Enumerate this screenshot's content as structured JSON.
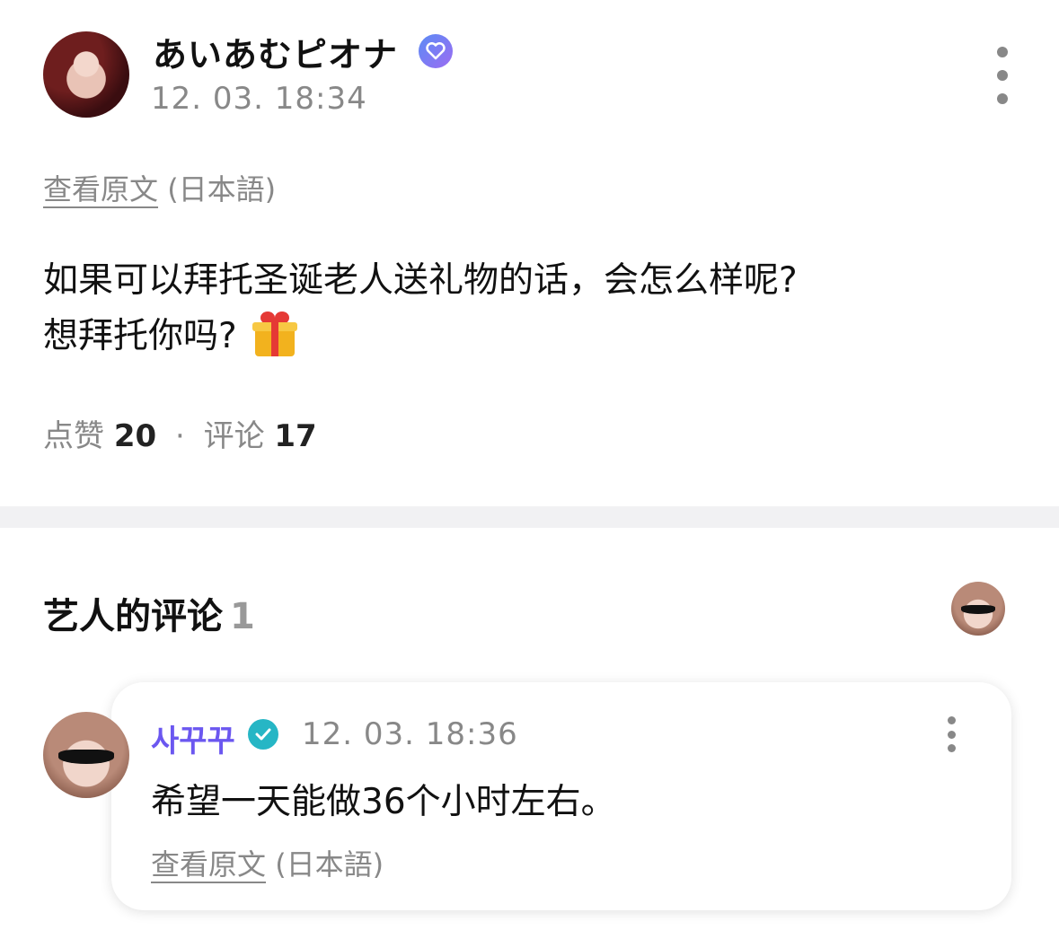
{
  "post": {
    "author_name": "あいあむピオナ",
    "timestamp": "12. 03. 18:34",
    "translate_link": "查看原文",
    "translate_lang": "(日本語)",
    "body_line1": "如果可以拜托圣诞老人送礼物的话，会怎么样呢?",
    "body_line2": "想拜托你吗?",
    "likes_label": "点赞",
    "likes_count": "20",
    "stats_separator": "·",
    "comments_label": "评论",
    "comments_count": "17"
  },
  "artist_comments": {
    "title": "艺人的评论",
    "count": "1"
  },
  "comment": {
    "author_name": "사꾸꾸",
    "timestamp": "12. 03. 18:36",
    "text": "希望一天能做36个小时左右。",
    "translate_link": "查看原文",
    "translate_lang": "(日本語)"
  },
  "icons": {
    "more": "more-vertical-icon",
    "verified": "verified-badge-icon",
    "gift": "gift-emoji"
  },
  "colors": {
    "artist_name": "#6b57f0",
    "verified_post": "#7b78f4",
    "verified_comment": "#26b6c5",
    "muted_text": "#888888",
    "divider": "#f1f1f3"
  }
}
